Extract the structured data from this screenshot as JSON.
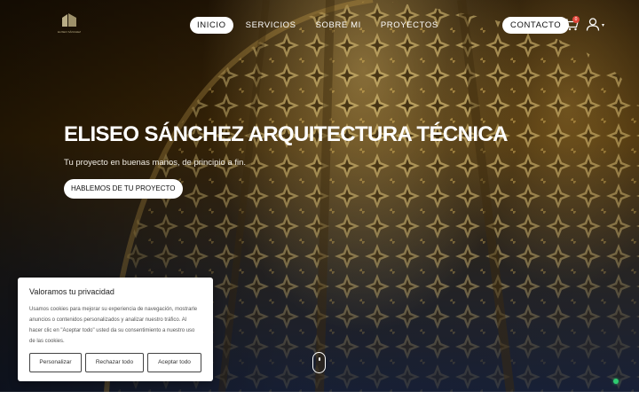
{
  "brand": {
    "logo_text": "ELISEO SÁNCHEZ",
    "icon": "building-logo-icon"
  },
  "nav": {
    "items": [
      {
        "label": "INICIO",
        "active": true
      },
      {
        "label": "SERVICIOS",
        "active": false
      },
      {
        "label": "SOBRE MI",
        "active": false
      },
      {
        "label": "PROYECTOS",
        "active": false
      }
    ],
    "contact_label": "CONTACTO",
    "cart_icon": "cart-icon",
    "cart_count": "0",
    "user_icon": "user-icon"
  },
  "hero": {
    "title": "ELISEO SÁNCHEZ ARQUITECTURA TÉCNICA",
    "subtitle": "Tu proyecto en buenas manos, de principio a fin.",
    "cta_label": "HABLEMOS DE TU PROYECTO",
    "scroll_icon": "scroll-mouse-icon"
  },
  "cookie_banner": {
    "title": "Valoramos tu privacidad",
    "text": "Usamos cookies para mejorar su experiencia de navegación, mostrarle anuncios o contenidos personalizados y analizar nuestro tráfico. Al hacer clic en \"Aceptar todo\" usted da su consentimiento a nuestro uso de las cookies.",
    "buttons": {
      "customize": "Personalizar",
      "reject": "Rechazar todo",
      "accept": "Aceptar todo"
    }
  },
  "colors": {
    "accent_gold": "#b9ad86",
    "badge_red": "#e2463a",
    "status_green": "#2ecc71"
  }
}
